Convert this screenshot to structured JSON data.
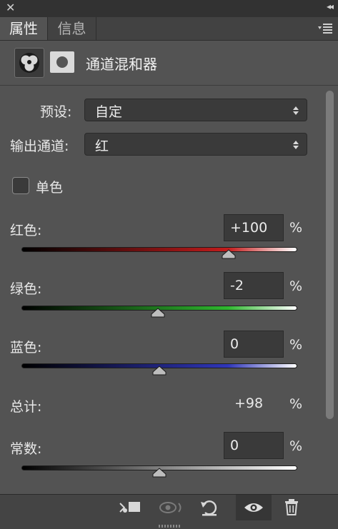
{
  "window": {
    "close_glyph": "✕",
    "collapse_glyph": "◂◂"
  },
  "tabs": [
    {
      "label": "属性"
    },
    {
      "label": "信息"
    }
  ],
  "panel": {
    "title": "通道混和器"
  },
  "controls": {
    "preset_label": "预设:",
    "preset_value": "自定",
    "output_channel_label": "输出通道:",
    "output_channel_value": "红",
    "monochrome_label": "单色",
    "monochrome_checked": false
  },
  "sliders": [
    {
      "label": "红色:",
      "value": "+100",
      "unit": "%",
      "level": 100,
      "min": -200,
      "max": 200
    },
    {
      "label": "绿色:",
      "value": "-2",
      "unit": "%",
      "level": -2,
      "min": -200,
      "max": 200
    },
    {
      "label": "蓝色:",
      "value": "0",
      "unit": "%",
      "level": 0,
      "min": -200,
      "max": 200
    }
  ],
  "total": {
    "label": "总计:",
    "value": "+98",
    "unit": "%"
  },
  "constant": {
    "label": "常数:",
    "value": "0",
    "unit": "%",
    "level": 0,
    "min": -200,
    "max": 200
  },
  "footer_icons": [
    "clip-to-layer-icon",
    "view-previous-icon",
    "reset-icon",
    "visibility-eye-icon",
    "trash-icon"
  ]
}
